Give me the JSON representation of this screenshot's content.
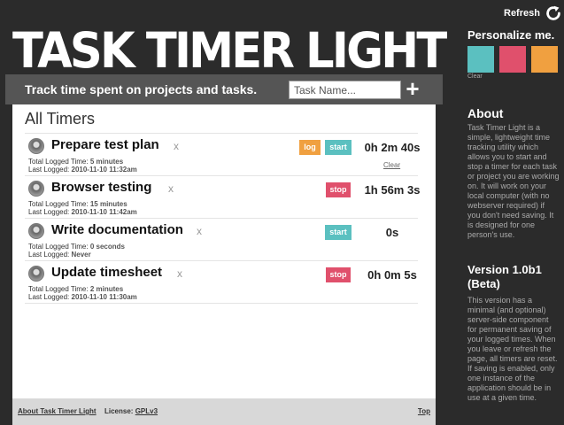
{
  "header": {
    "refresh_label": "Refresh",
    "app_title": "TASK TIMER LIGHT",
    "tagline": "Track time spent on projects and tasks.",
    "task_input_placeholder": "Task Name...",
    "add_label": "+"
  },
  "main": {
    "title": "All Timers",
    "timers": [
      {
        "name": "Prepare test plan",
        "delete": "x",
        "total_label": "Total Logged Time:",
        "total_value": "5 minutes",
        "last_label": "Last Logged:",
        "last_value": "2010-11-10 11:32am",
        "log_label": "log",
        "action_label": "start",
        "action": "start",
        "time": "0h 2m 40s",
        "clear_label": "Clear"
      },
      {
        "name": "Browser testing",
        "delete": "x",
        "total_label": "Total Logged Time:",
        "total_value": "15 minutes",
        "last_label": "Last Logged:",
        "last_value": "2010-11-10 11:42am",
        "action_label": "stop",
        "action": "stop",
        "time": "1h 56m 3s"
      },
      {
        "name": "Write documentation",
        "delete": "x",
        "total_label": "Total Logged Time:",
        "total_value": "0 seconds",
        "last_label": "Last Logged:",
        "last_value": "Never",
        "action_label": "start",
        "action": "start",
        "time": "0s"
      },
      {
        "name": "Update timesheet",
        "delete": "x",
        "total_label": "Total Logged Time:",
        "total_value": "2 minutes",
        "last_label": "Last Logged:",
        "last_value": "2010-11-10 11:30am",
        "action_label": "stop",
        "action": "stop",
        "time": "0h 0m 5s"
      }
    ]
  },
  "footer": {
    "about_link": "About Task Timer Light",
    "license_label": "License:",
    "license_link": "GPLv3",
    "top_link": "Top"
  },
  "sidebar": {
    "personalize_title": "Personalize me.",
    "swatches": [
      {
        "name": "teal",
        "color": "#5bc0c0"
      },
      {
        "name": "pink",
        "color": "#e0506c"
      },
      {
        "name": "orange",
        "color": "#f0a040"
      }
    ],
    "clear_label": "Clear",
    "about_title": "About",
    "about_text": "Task Timer Light is a simple, lightweight time tracking utility which allows you to start and stop a timer for each task or project you are working on. It will work on your local computer (with no webserver required) if you don't need saving. It is designed for one person's use.",
    "version_title": "Version 1.0b1 (Beta)",
    "version_text": "This version has a minimal (and optional) server-side component for permanent saving of your logged times. When you leave or refresh the page, all timers are reset. If saving is enabled, only one instance of the application should be in use at a given time."
  }
}
